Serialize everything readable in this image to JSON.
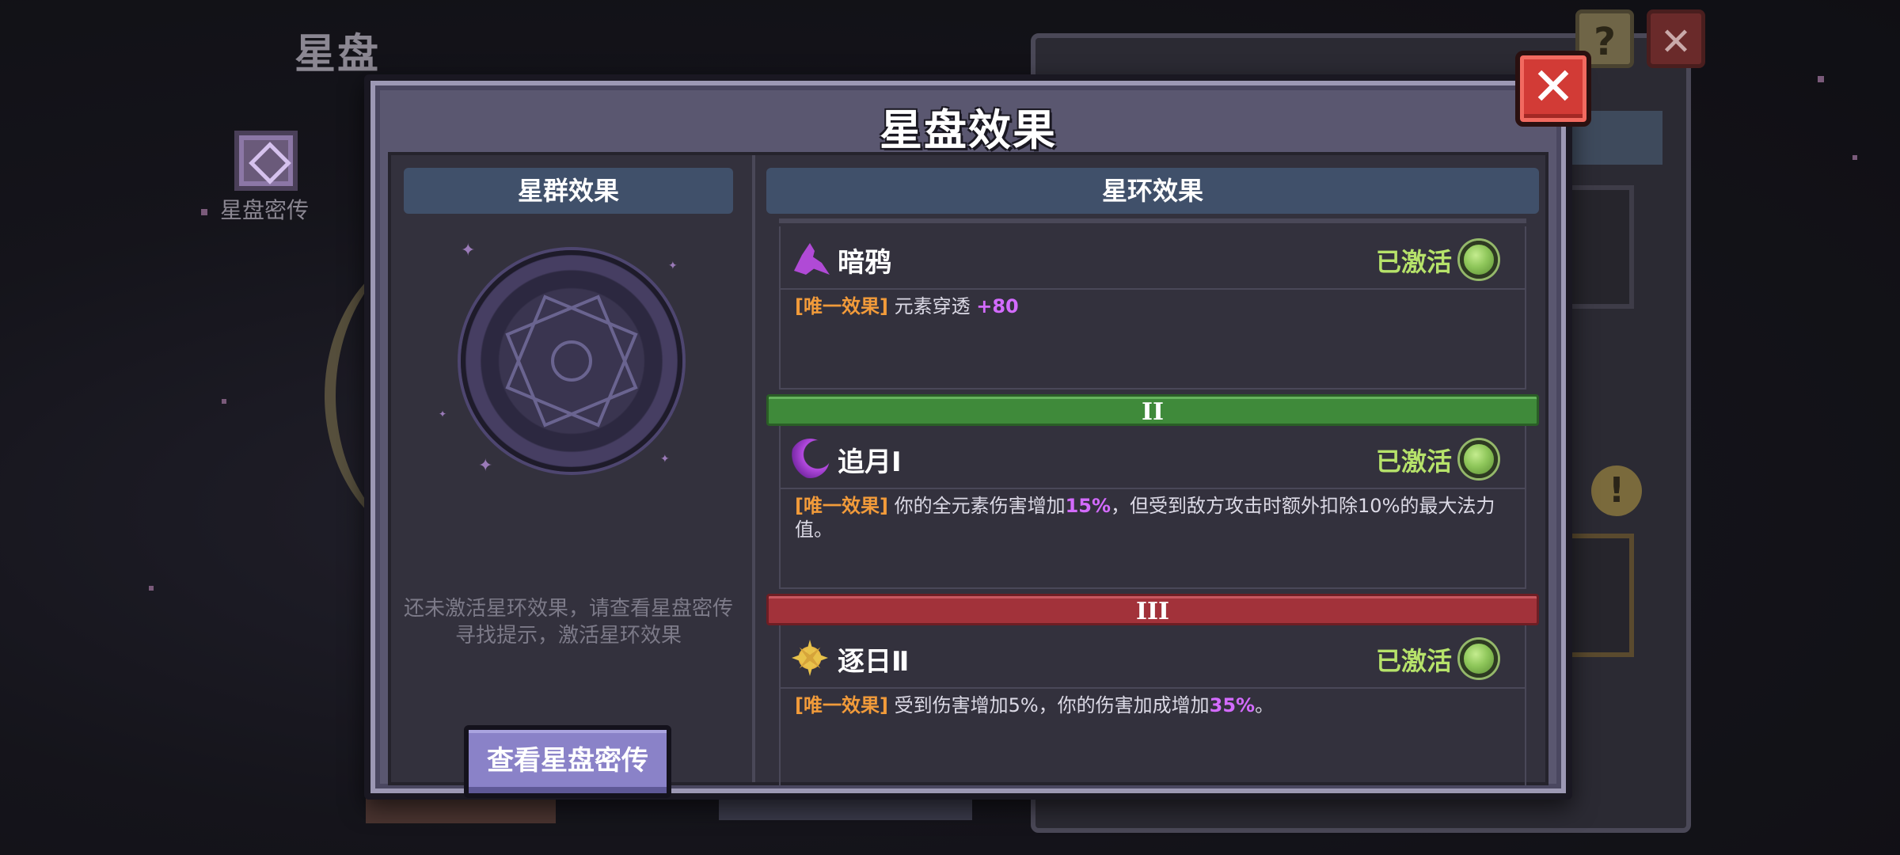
{
  "background": {
    "title": "星盘",
    "secret_label": "星盘密传",
    "help_icon": "?",
    "close_icon": "✕",
    "alert_icon": "!"
  },
  "modal": {
    "title": "星盘效果",
    "close_icon": "✕",
    "left": {
      "header": "星群效果",
      "hint": "还未激活星环效果，请查看星盘密传寻找提示，激活星环效果",
      "button": "查看星盘密传"
    },
    "right": {
      "header": "星环效果",
      "cards": [
        {
          "name": "暗鸦",
          "icon": "crow-icon",
          "status": "已激活",
          "tag": "[唯一效果]",
          "desc": [
            {
              "text": "元素穿透 ",
              "hl": false
            },
            {
              "text": "+80",
              "hl": true
            }
          ]
        },
        {
          "tier": "II",
          "name": "追月Ⅰ",
          "icon": "moon-icon",
          "status": "已激活",
          "tag": "[唯一效果]",
          "desc": [
            {
              "text": "你的全元素伤害增加",
              "hl": false
            },
            {
              "text": "15%",
              "hl": true
            },
            {
              "text": "，但受到敌方攻击时额外扣除10%的最大法力值。",
              "hl": false
            }
          ]
        },
        {
          "tier": "III",
          "name": "逐日Ⅱ",
          "icon": "sun-icon",
          "status": "已激活",
          "tag": "[唯一效果]",
          "desc": [
            {
              "text": "受到伤害增加5%，你的伤害加成增加",
              "hl": false
            },
            {
              "text": "35%",
              "hl": true
            },
            {
              "text": "。",
              "hl": false
            }
          ]
        }
      ]
    }
  },
  "colors": {
    "status_active": "#b6e26a",
    "unique_tag": "#f29b3a",
    "highlight": "#d36bff",
    "tier2": "#3f8a3a",
    "tier3": "#a2323a",
    "close_button": "#d23b36",
    "header_bar": "#40506a"
  }
}
